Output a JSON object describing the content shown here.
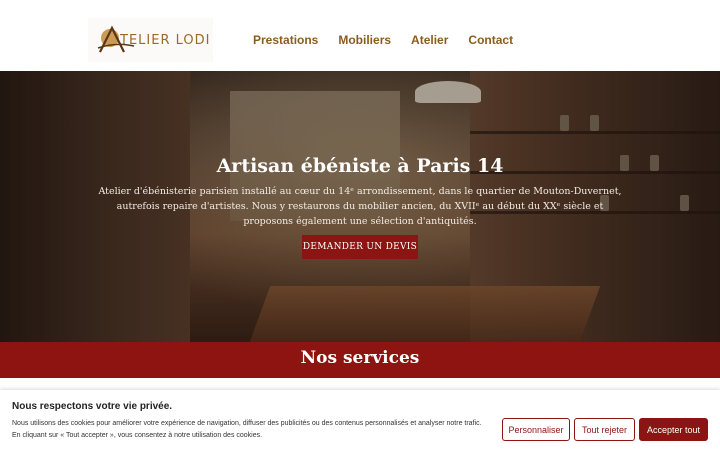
{
  "header": {
    "logo_text": "TELIER LODI",
    "nav": [
      {
        "label": "Prestations"
      },
      {
        "label": "Mobiliers"
      },
      {
        "label": "Atelier"
      },
      {
        "label": "Contact"
      }
    ]
  },
  "hero": {
    "title": "Artisan ébéniste à Paris 14",
    "text": "Atelier d'ébénisterie parisien installé au cœur du 14ᵉ arrondissement, dans le quartier de Mouton-Duvernet, autrefois repaire d'artistes. Nous y restaurons du mobilier ancien, du XVIIᵉ au début du XXᵉ siècle et proposons également une sélection d'antiquités.",
    "button_label": "DEMANDER UN DEVIS"
  },
  "services": {
    "title": "Nos services"
  },
  "cookie": {
    "title": "Nous respectons votre vie privée.",
    "text": "Nous utilisons des cookies pour améliorer votre expérience de navigation, diffuser des publicités ou des contenus personnalisés et analyser notre trafic. En cliquant sur « Tout accepter », vous consentez à notre utilisation des cookies.",
    "customize_label": "Personnaliser",
    "reject_label": "Tout rejeter",
    "accept_label": "Accepter tout"
  },
  "colors": {
    "brand_red": "#8b1513",
    "nav_gold": "#8a5d1f"
  },
  "icons": {
    "logo": "atelier-lodi-logo-icon"
  }
}
